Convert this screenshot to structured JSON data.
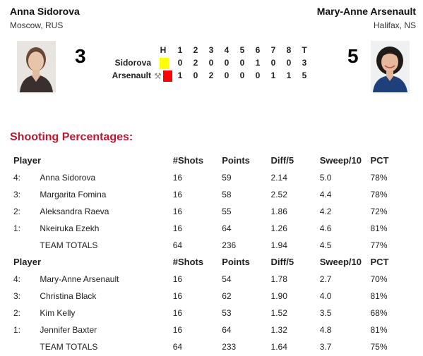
{
  "left_skip": {
    "name": "Anna Sidorova",
    "location": "Moscow, RUS",
    "score": "3"
  },
  "right_skip": {
    "name": "Mary-Anne Arsenault",
    "location": "Halifax, NS",
    "score": "5"
  },
  "linescore": {
    "headers": [
      "H",
      "1",
      "2",
      "3",
      "4",
      "5",
      "6",
      "7",
      "8",
      "T"
    ],
    "rows": [
      {
        "team": "Sidorova",
        "stone_color": "#ffff00",
        "hammer": false,
        "ends": [
          "0",
          "2",
          "0",
          "0",
          "0",
          "1",
          "0",
          "0"
        ],
        "total": "3"
      },
      {
        "team": "Arsenault",
        "stone_color": "#ff0000",
        "hammer": true,
        "ends": [
          "1",
          "0",
          "2",
          "0",
          "0",
          "0",
          "1",
          "1"
        ],
        "total": "5"
      }
    ]
  },
  "section_title": "Shooting Percentages:",
  "columns": [
    "Player",
    "#Shots",
    "Points",
    "Diff/5",
    "Sweep/10",
    "PCT"
  ],
  "teams": [
    {
      "players": [
        {
          "pos": "4:",
          "name": "Anna Sidorova",
          "shots": "16",
          "points": "59",
          "diff": "2.14",
          "sweep": "5.0",
          "pct": "78%"
        },
        {
          "pos": "3:",
          "name": "Margarita Fomina",
          "shots": "16",
          "points": "58",
          "diff": "2.52",
          "sweep": "4.4",
          "pct": "78%"
        },
        {
          "pos": "2:",
          "name": "Aleksandra Raeva",
          "shots": "16",
          "points": "55",
          "diff": "1.86",
          "sweep": "4.2",
          "pct": "72%"
        },
        {
          "pos": "1:",
          "name": "Nkeiruka Ezekh",
          "shots": "16",
          "points": "64",
          "diff": "1.26",
          "sweep": "4.6",
          "pct": "81%"
        }
      ],
      "totals": {
        "label": "TEAM TOTALS",
        "shots": "64",
        "points": "236",
        "diff": "1.94",
        "sweep": "4.5",
        "pct": "77%"
      }
    },
    {
      "players": [
        {
          "pos": "4:",
          "name": "Mary-Anne Arsenault",
          "shots": "16",
          "points": "54",
          "diff": "1.78",
          "sweep": "2.7",
          "pct": "70%"
        },
        {
          "pos": "3:",
          "name": "Christina Black",
          "shots": "16",
          "points": "62",
          "diff": "1.90",
          "sweep": "4.0",
          "pct": "81%"
        },
        {
          "pos": "2:",
          "name": "Kim Kelly",
          "shots": "16",
          "points": "53",
          "diff": "1.52",
          "sweep": "3.5",
          "pct": "68%"
        },
        {
          "pos": "1:",
          "name": "Jennifer Baxter",
          "shots": "16",
          "points": "64",
          "diff": "1.32",
          "sweep": "4.8",
          "pct": "81%"
        }
      ],
      "totals": {
        "label": "TEAM TOTALS",
        "shots": "64",
        "points": "233",
        "diff": "1.64",
        "sweep": "3.7",
        "pct": "75%"
      }
    }
  ]
}
